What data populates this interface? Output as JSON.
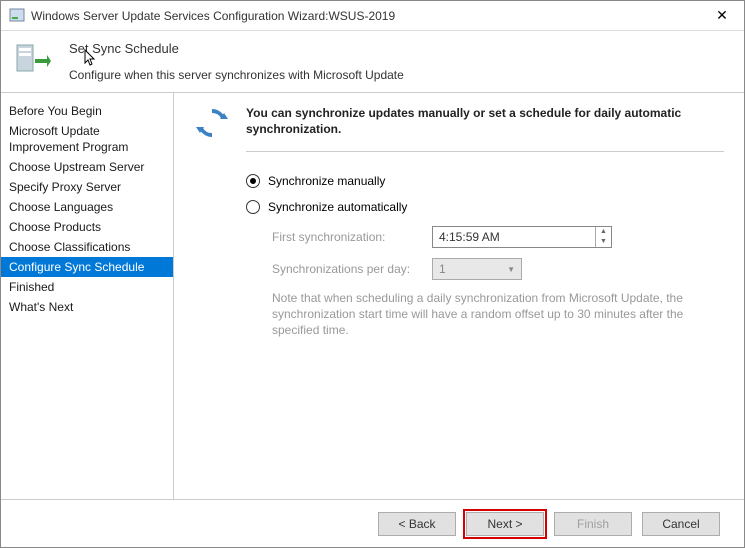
{
  "titlebar": {
    "title": "Windows Server Update Services Configuration Wizard:WSUS-2019"
  },
  "header": {
    "title": "Set Sync Schedule",
    "subtitle": "Configure when this server synchronizes with Microsoft Update"
  },
  "sidebar": {
    "items": [
      {
        "label": "Before You Begin"
      },
      {
        "label": "Microsoft Update Improvement Program"
      },
      {
        "label": "Choose Upstream Server"
      },
      {
        "label": "Specify Proxy Server"
      },
      {
        "label": "Choose Languages"
      },
      {
        "label": "Choose Products"
      },
      {
        "label": "Choose Classifications"
      },
      {
        "label": "Configure Sync Schedule"
      },
      {
        "label": "Finished"
      },
      {
        "label": "What's Next"
      }
    ],
    "selected_index": 7
  },
  "main": {
    "intro": "You can synchronize updates manually or set a schedule for daily automatic synchronization.",
    "radio_manual": "Synchronize manually",
    "radio_auto": "Synchronize automatically",
    "selected_radio": "manual",
    "first_sync_label": "First synchronization:",
    "first_sync_value": "4:15:59 AM",
    "per_day_label": "Synchronizations per day:",
    "per_day_value": "1",
    "note": "Note that when scheduling a daily synchronization from Microsoft Update, the synchronization start time will have a random offset up to 30 minutes after the specified time."
  },
  "footer": {
    "back": "< Back",
    "next": "Next >",
    "finish": "Finish",
    "cancel": "Cancel"
  }
}
